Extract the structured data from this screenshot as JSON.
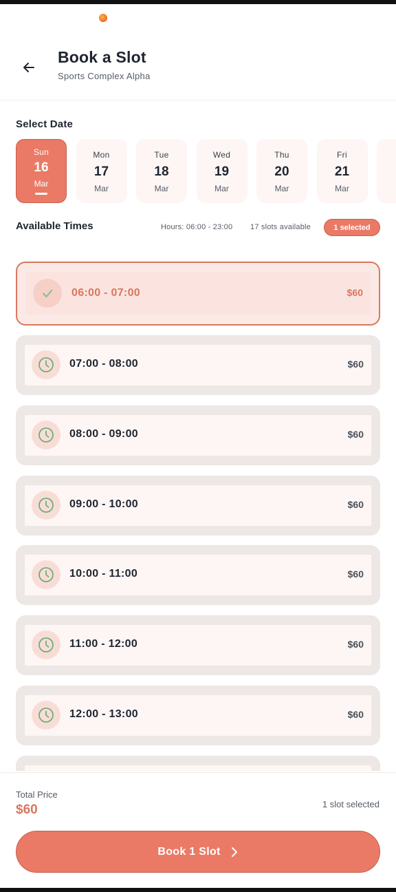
{
  "header": {
    "title": "Book a Slot",
    "subtitle": "Sports Complex Alpha",
    "back_icon": "arrow-left-icon"
  },
  "date_section": {
    "label": "Select Date",
    "dates": [
      {
        "dow": "Sun",
        "day": "16",
        "month": "Mar",
        "selected": true
      },
      {
        "dow": "Mon",
        "day": "17",
        "month": "Mar",
        "selected": false
      },
      {
        "dow": "Tue",
        "day": "18",
        "month": "Mar",
        "selected": false
      },
      {
        "dow": "Wed",
        "day": "19",
        "month": "Mar",
        "selected": false
      },
      {
        "dow": "Thu",
        "day": "20",
        "month": "Mar",
        "selected": false
      },
      {
        "dow": "Fri",
        "day": "21",
        "month": "Mar",
        "selected": false
      }
    ]
  },
  "times_section": {
    "label": "Available Times",
    "hours": "Hours: 06:00 - 23:00",
    "slots_available": "17 slots available",
    "selected_badge": "1 selected"
  },
  "slots": [
    {
      "time": "06:00 - 07:00",
      "price": "$60",
      "selected": true
    },
    {
      "time": "07:00 - 08:00",
      "price": "$60",
      "selected": false
    },
    {
      "time": "08:00 - 09:00",
      "price": "$60",
      "selected": false
    },
    {
      "time": "09:00 - 10:00",
      "price": "$60",
      "selected": false
    },
    {
      "time": "10:00 - 11:00",
      "price": "$60",
      "selected": false
    },
    {
      "time": "11:00 - 12:00",
      "price": "$60",
      "selected": false
    },
    {
      "time": "12:00 - 13:00",
      "price": "$60",
      "selected": false
    }
  ],
  "footer": {
    "total_label": "Total Price",
    "total_value": "$60",
    "slot_count": "1 slot selected",
    "book_button": "Book 1 Slot"
  },
  "colors": {
    "accent": "#ea7a66",
    "accent_dark": "#d9775f",
    "clock_green": "#6fae7d"
  }
}
